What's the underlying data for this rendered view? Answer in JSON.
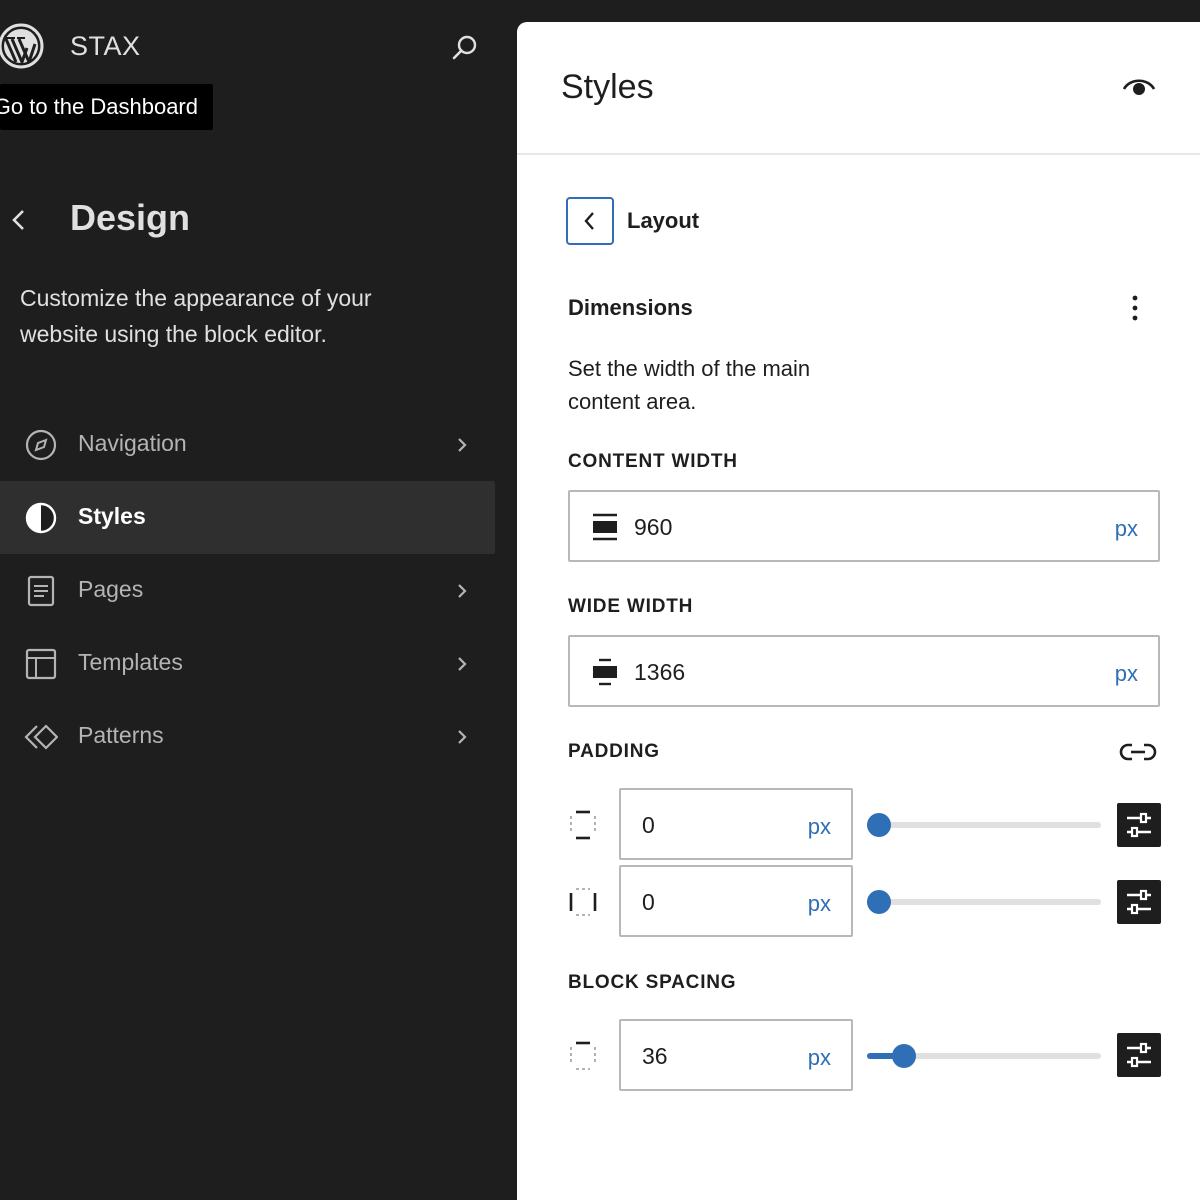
{
  "sidebar": {
    "site_name": "STAX",
    "tooltip": "Go to the Dashboard",
    "title": "Design",
    "description": "Customize the appearance of your website using the block editor.",
    "items": [
      {
        "label": "Navigation",
        "icon": "compass-icon",
        "active": false
      },
      {
        "label": "Styles",
        "icon": "half-circle-icon",
        "active": true
      },
      {
        "label": "Pages",
        "icon": "page-icon",
        "active": false
      },
      {
        "label": "Templates",
        "icon": "layout-icon",
        "active": false
      },
      {
        "label": "Patterns",
        "icon": "symbol-icon",
        "active": false
      }
    ]
  },
  "panel": {
    "title": "Styles",
    "section": "Layout",
    "dimensions": {
      "title": "Dimensions",
      "description": "Set the width of the main content area.",
      "content_width": {
        "label": "CONTENT WIDTH",
        "value": "960",
        "unit": "px"
      },
      "wide_width": {
        "label": "WIDE WIDTH",
        "value": "1366",
        "unit": "px"
      },
      "padding": {
        "label": "PADDING",
        "vertical": {
          "value": "0",
          "unit": "px",
          "slider_fraction": 0.0
        },
        "horizontal": {
          "value": "0",
          "unit": "px",
          "slider_fraction": 0.0
        }
      },
      "block_spacing": {
        "label": "BLOCK SPACING",
        "value": "36",
        "unit": "px",
        "slider_fraction": 0.12
      }
    }
  },
  "colors": {
    "sidebar_bg": "#1e1e1e",
    "active_item_bg": "#2f2f2f",
    "accent": "#2f6fb5",
    "panel_bg": "#ffffff"
  }
}
